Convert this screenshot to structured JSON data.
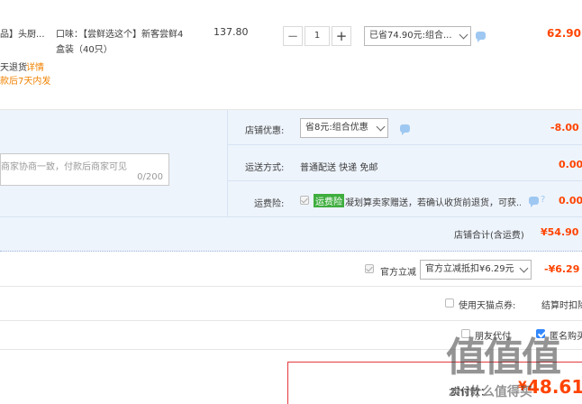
{
  "item": {
    "title_fragment": "品】头厨...",
    "spec_line1": "口味：【尝鲜选这个】新客尝鲜4",
    "spec_line2": "盒装（40只）",
    "unit_price": "137.80",
    "quantity": "1",
    "qty_minus": "−",
    "qty_plus": "+",
    "promo_select": "已省74.90元:组合...",
    "subtotal": "62.90",
    "service_label": "天退货",
    "service_detail": "详情",
    "service_note": "款后7天内发"
  },
  "shop": {
    "message_placeholder": "商家协商一致，付款后商家可见",
    "message_counter": "0/200",
    "discount_label": "店铺优惠:",
    "discount_select": "省8元:组合优惠",
    "discount_value": "-8.00",
    "shipping_label": "运送方式:",
    "shipping_value": "普通配送 快递 免邮",
    "shipping_cost": "0.00",
    "insurance_label": "运费险:",
    "insurance_tag": "运费险",
    "insurance_text": "凝划算卖家赠送，若确认收货前退货，可获...",
    "insurance_cost": "0.00",
    "total_label": "店铺合计(含运费)",
    "total_value": "¥54.90"
  },
  "official": {
    "label": "官方立减",
    "select": "官方立减抵扣¥6.29元",
    "value": "-¥6.29"
  },
  "points": {
    "label": "使用天猫点券:",
    "note": "结算时扣除"
  },
  "options": {
    "pay_for_other": "朋友代付",
    "anonymous": "匿名购买"
  },
  "payment": {
    "label": "实付款：",
    "currency": "¥",
    "amount": "48.61"
  },
  "watermark": {
    "big": "值值值",
    "site": "zhi什么值得买"
  }
}
